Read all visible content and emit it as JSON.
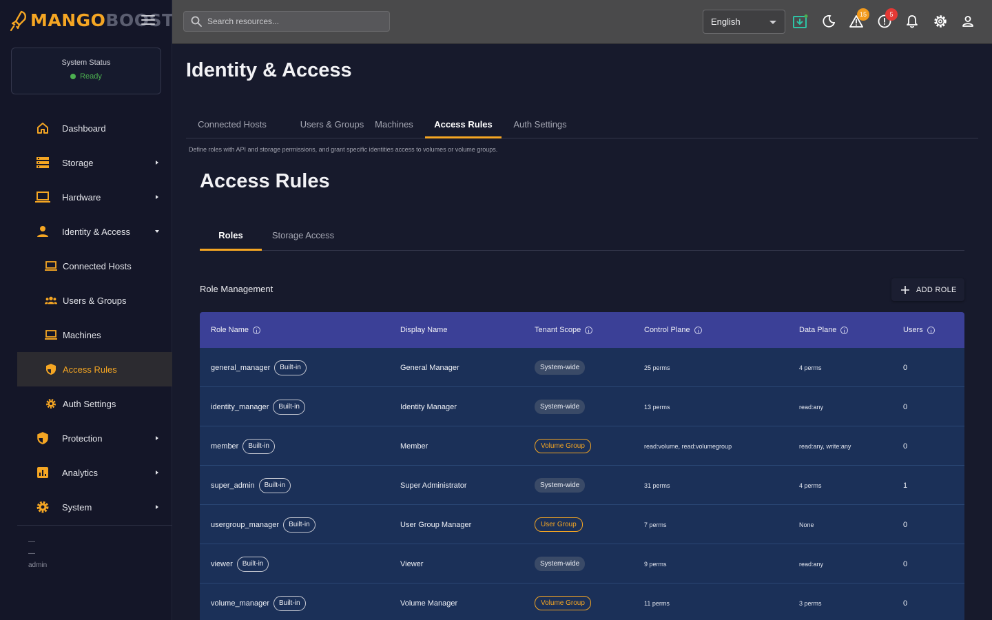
{
  "app": {
    "brand_primary": "MANGO",
    "brand_secondary": "BOOST",
    "accent_color": "#f5a623"
  },
  "sidebar": {
    "status_title": "System Status",
    "status_value": "Ready",
    "items": [
      {
        "label": "Dashboard",
        "icon": "home-icon"
      },
      {
        "label": "Storage",
        "icon": "storage-icon"
      },
      {
        "label": "Hardware",
        "icon": "laptop-icon"
      },
      {
        "label": "Identity & Access",
        "icon": "person-icon"
      },
      {
        "label": "Connected Hosts",
        "icon": "laptop-icon"
      },
      {
        "label": "Users & Groups",
        "icon": "groups-icon"
      },
      {
        "label": "Machines",
        "icon": "laptop-icon"
      },
      {
        "label": "Access Rules",
        "icon": "shield-icon"
      },
      {
        "label": "Auth Settings",
        "icon": "gear-icon"
      },
      {
        "label": "Protection",
        "icon": "shield-icon"
      },
      {
        "label": "Analytics",
        "icon": "analytics-icon"
      },
      {
        "label": "System",
        "icon": "gear-icon"
      }
    ],
    "footer": [
      "—",
      "—",
      "admin"
    ]
  },
  "topbar": {
    "search_placeholder": "Search resources...",
    "language": "English",
    "warning_count": "15",
    "error_count": "5"
  },
  "page": {
    "title": "Identity & Access",
    "tabs": [
      "Connected Hosts",
      "Users & Groups",
      "Machines",
      "Access Rules",
      "Auth Settings"
    ],
    "description": "Define roles with API and storage permissions, and grant specific identities access to volumes or volume groups.",
    "section_title": "Access Rules",
    "inner_tabs": [
      "Roles",
      "Storage Access"
    ],
    "role_management_title": "Role Management",
    "add_role_label": "ADD ROLE"
  },
  "table": {
    "headers": [
      "Role Name",
      "Display Name",
      "Tenant Scope",
      "Control Plane",
      "Data Plane",
      "Users"
    ],
    "builtin_label": "Built-in",
    "rows": [
      {
        "role": "general_manager",
        "display": "General Manager",
        "scope": "System-wide",
        "control": "25 perms",
        "data": "4 perms",
        "users": "0"
      },
      {
        "role": "identity_manager",
        "display": "Identity Manager",
        "scope": "System-wide",
        "control": "13 perms",
        "data": "read:any",
        "users": "0"
      },
      {
        "role": "member",
        "display": "Member",
        "scope": "Volume Group",
        "control": "read:volume, read:volumegroup",
        "data": "read:any, write:any",
        "users": "0"
      },
      {
        "role": "super_admin",
        "display": "Super Administrator",
        "scope": "System-wide",
        "control": "31 perms",
        "data": "4 perms",
        "users": "1"
      },
      {
        "role": "usergroup_manager",
        "display": "User Group Manager",
        "scope": "User Group",
        "control": "7 perms",
        "data": "None",
        "users": "0"
      },
      {
        "role": "viewer",
        "display": "Viewer",
        "scope": "System-wide",
        "control": "9 perms",
        "data": "read:any",
        "users": "0"
      },
      {
        "role": "volume_manager",
        "display": "Volume Manager",
        "scope": "Volume Group",
        "control": "11 perms",
        "data": "3 perms",
        "users": "0"
      }
    ]
  }
}
